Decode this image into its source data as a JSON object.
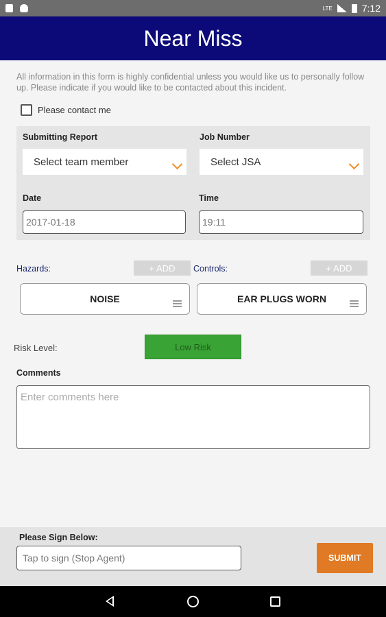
{
  "status_bar": {
    "time": "7:12",
    "network_label": "LTE",
    "icons": [
      "notification-icon",
      "android-icon",
      "signal-icon",
      "battery-icon"
    ]
  },
  "app": {
    "title": "Near Miss",
    "header_color": "#0c0a78"
  },
  "form": {
    "intro_text": "All information in this form is highly confidential unless you would like us to personally follow up. Please indicate if you would like to be contacted about this incident.",
    "contact_label": "Please contact me",
    "contact_checked": false,
    "submitting_report": {
      "label": "Submitting Report",
      "value": "Select team member"
    },
    "job_number": {
      "label": "Job Number",
      "value": "Select JSA"
    },
    "date": {
      "label": "Date",
      "value": "2017-01-18"
    },
    "time": {
      "label": "Time",
      "value": "19:11"
    },
    "hazards": {
      "label": "Hazards:",
      "add_label": "+ ADD",
      "items": [
        "NOISE"
      ]
    },
    "controls": {
      "label": "Controls:",
      "add_label": "+ ADD",
      "items": [
        "EAR PLUGS WORN"
      ]
    },
    "risk_level": {
      "label": "Risk Level:",
      "value": "Low Risk",
      "color": "#3aa335"
    },
    "comments": {
      "label": "Comments",
      "placeholder": "Enter comments here"
    }
  },
  "footer": {
    "sign_label": "Please Sign Below:",
    "sign_placeholder": "Tap to sign (Stop Agent)",
    "submit_label": "SUBMIT",
    "submit_color": "#e07a24"
  }
}
